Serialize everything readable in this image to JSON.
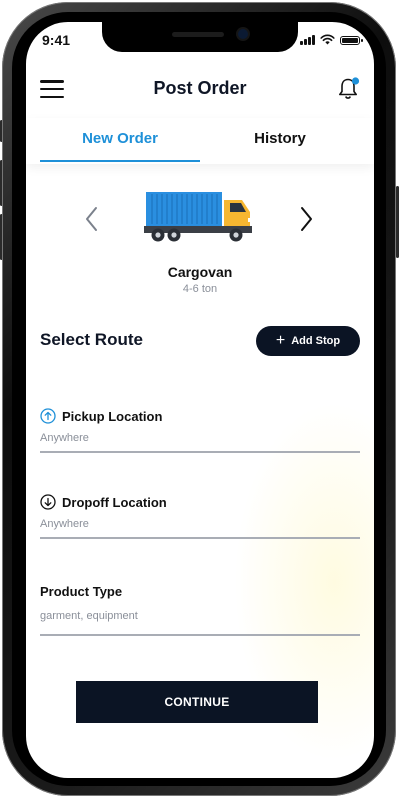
{
  "status_bar": {
    "time": "9:41"
  },
  "header": {
    "title": "Post Order",
    "menu_icon": "hamburger-menu-icon",
    "notification_icon": "bell-icon",
    "notification_dot_color": "#1e90d8"
  },
  "tabs": [
    {
      "label": "New Order",
      "active": true
    },
    {
      "label": "History",
      "active": false
    }
  ],
  "vehicle": {
    "name": "Cargovan",
    "capacity": "4-6 ton",
    "icon": "truck-icon",
    "container_color": "#2a8fe0",
    "cab_color": "#f7b731"
  },
  "route": {
    "title": "Select Route",
    "add_stop_label": "Add Stop"
  },
  "fields": {
    "pickup": {
      "label": "Pickup Location",
      "value": "Anywhere",
      "icon": "arrow-up-circle-icon"
    },
    "dropoff": {
      "label": "Dropoff Location",
      "value": "Anywhere",
      "icon": "arrow-down-circle-icon"
    },
    "product": {
      "label": "Product Type",
      "value": "garment, equipment"
    }
  },
  "continue_label": "CONTINUE",
  "colors": {
    "accent": "#1e90d8",
    "dark_button": "#0b1424",
    "muted_text": "#8a8f99"
  }
}
